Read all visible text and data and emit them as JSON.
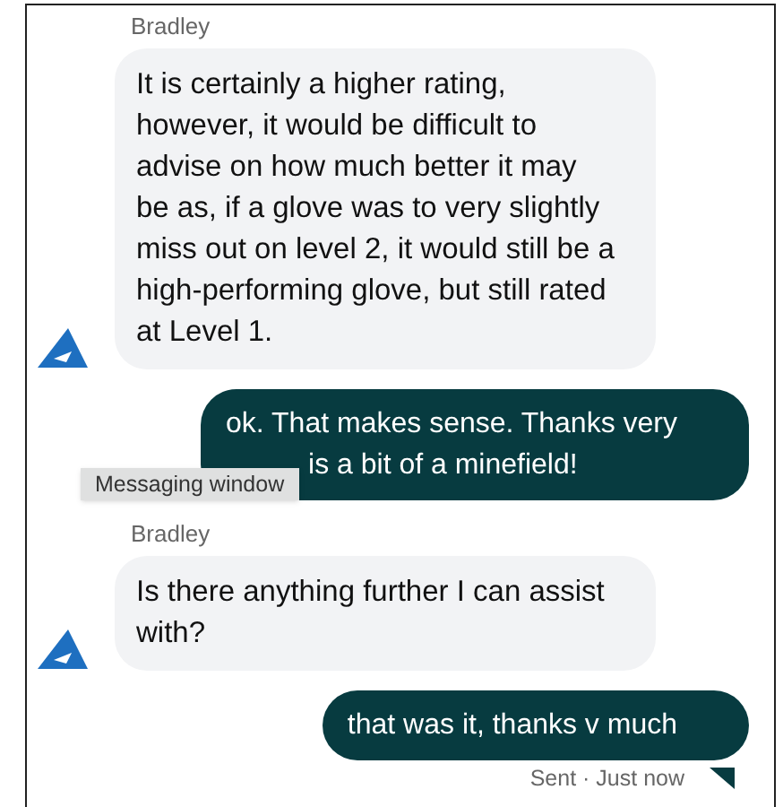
{
  "messages": [
    {
      "kind": "agent",
      "sender": "Bradley",
      "text": "It is certainly a higher rating, however, it would be difficult to advise on how much better it may be as, if a glove was to very slightly miss out on level 2, it would still be a high-performing glove, but still rated at Level 1."
    },
    {
      "kind": "user",
      "lines": [
        "ok. That makes sense. Thanks very",
        "is a bit of a minefield!"
      ],
      "tooltip": "Messaging window"
    },
    {
      "kind": "agent",
      "sender": "Bradley",
      "text": "Is there anything further I can assist with?"
    },
    {
      "kind": "user",
      "lines": [
        "that was it, thanks v much"
      ],
      "status": "Sent · Just now"
    }
  ]
}
